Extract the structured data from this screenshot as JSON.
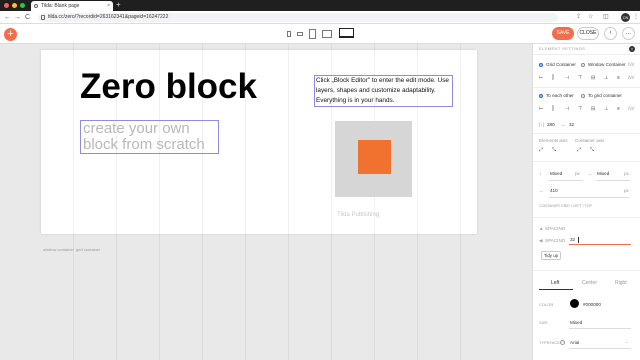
{
  "browser": {
    "tab_title": "Tilda: Blank page",
    "tab_close": "×",
    "new_tab": "+",
    "url": "tilda.cc/zero/?recordid=263162341&pageid=16247222",
    "back": "←",
    "forward": "→",
    "reload": "C",
    "profile": "CN",
    "share_icon": "⇪",
    "star_icon": "☆",
    "ext_icon": "◫",
    "menu_icon": "⋮"
  },
  "topbar": {
    "add_label": "+",
    "save_label": "SAVE",
    "close_label": "CLOSE",
    "more1_label": "‹",
    "more2_label": "…"
  },
  "canvas": {
    "heading": "Zero block",
    "subtext": "create your own block from scratch",
    "description": "Click „Block Editor\" to enter the edit mode. Use layers, shapes and customize adaptability. Everything is in your hands.",
    "caption": "Tilda Publishing",
    "below_label_left": "window container",
    "below_label_right": "grid container",
    "accent_color": "#f1712e"
  },
  "panel": {
    "header": "ELEMENT SETTINGS",
    "close": "×",
    "container": {
      "grid_label": "Grid Container",
      "window_label": "Window Container"
    },
    "relative": {
      "each_other_label": "To each other",
      "grid_label": "To grid container"
    },
    "slash_label": "/\\/\\/",
    "coords": {
      "x_prefix": "[↕]",
      "x_value": "280",
      "y_prefix": "↔",
      "y_value": "32"
    },
    "axis": {
      "elements_label": "Elements axis",
      "container_label": "Container axis"
    },
    "size": {
      "w_prefix": "↕",
      "w_value": "Mixed",
      "w_unit": "px",
      "h_prefix": "↔",
      "h_value": "Mixed",
      "h_unit": "px"
    },
    "width": {
      "prefix": "↔",
      "value": "410",
      "unit": "px"
    },
    "container_row": "CONTAINER   GRID / LEFT / TOP",
    "spacing1": {
      "prefix": "▲",
      "label": "SPACING"
    },
    "spacing2": {
      "prefix": "◀",
      "label": "SPACING",
      "value": "32"
    },
    "tidy_label": "Tidy up",
    "align_tabs": [
      "Left",
      "Center",
      "Right"
    ],
    "color": {
      "label": "COLOR",
      "value": "#000000",
      "swatch": "#000000"
    },
    "size_row": {
      "label": "SIZE",
      "value": "Mixed"
    },
    "typeface": {
      "label": "TYPEFACE",
      "info": "i",
      "value": "Arial"
    }
  }
}
